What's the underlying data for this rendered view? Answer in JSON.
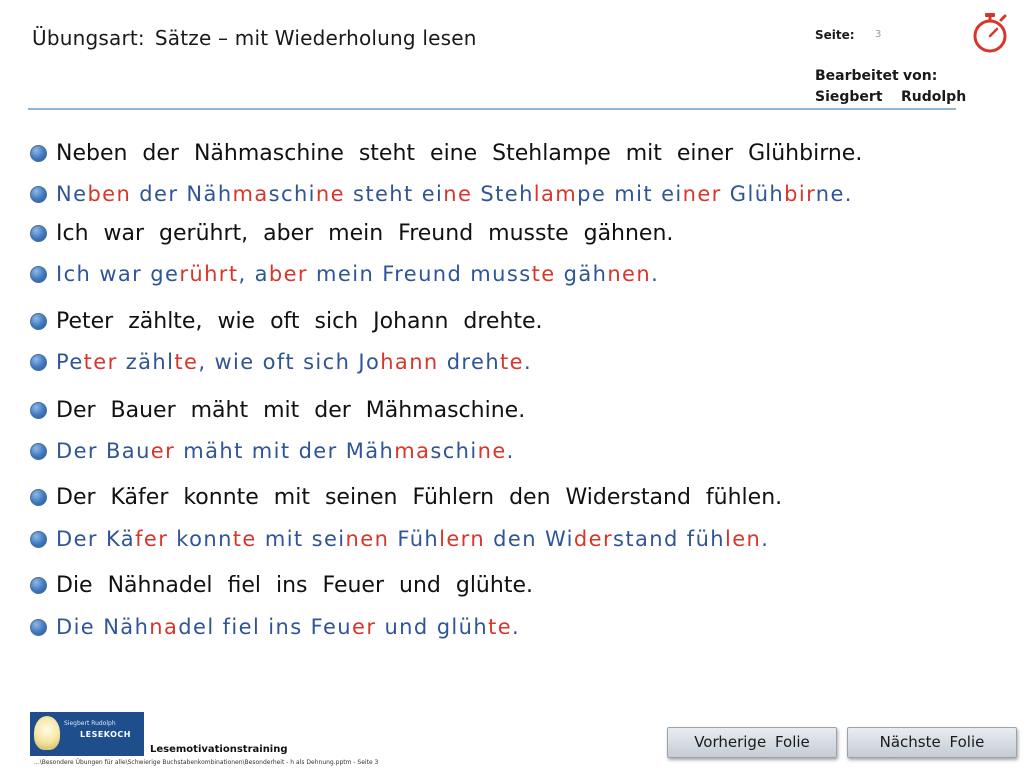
{
  "header": {
    "exercise_label": "Übungsart:",
    "exercise_value": "Sätze – mit Wiederholung lesen",
    "page_label": "Seite:",
    "page_number": "3",
    "edited_label_1": "Bearbeitet",
    "edited_label_2": "von:",
    "editor_first": "Siegbert",
    "editor_last": "Rudolph"
  },
  "icons": {
    "timer": "stopwatch-icon",
    "bullet": "blue-circle-bullet-icon"
  },
  "colors": {
    "syllable_blue": "#2f5597",
    "syllable_red": "#d9362b",
    "rule": "#8fb3d9"
  },
  "sentences": [
    {
      "plain": "Neben der Nähmaschine steht eine Stehlampe mit einer Glühbirne.",
      "segments": [
        [
          "Ne",
          0
        ],
        [
          "ben",
          1
        ],
        [
          " der Näh",
          0
        ],
        [
          "ma",
          1
        ],
        [
          "schi",
          0
        ],
        [
          "ne",
          1
        ],
        [
          " steht ei",
          0
        ],
        [
          "ne",
          1
        ],
        [
          " Steh",
          0
        ],
        [
          "lam",
          1
        ],
        [
          "pe mit ei",
          0
        ],
        [
          "ner",
          1
        ],
        [
          " Glüh",
          0
        ],
        [
          "bir",
          1
        ],
        [
          "ne.",
          0
        ]
      ]
    },
    {
      "plain": "Ich war gerührt, aber mein Freund musste gähnen.",
      "segments": [
        [
          "Ich war ge",
          0
        ],
        [
          "rührt",
          1
        ],
        [
          ", a",
          0
        ],
        [
          "ber",
          1
        ],
        [
          " mein Freund muss",
          0
        ],
        [
          "te",
          1
        ],
        [
          " gäh",
          0
        ],
        [
          "nen",
          1
        ],
        [
          ".",
          0
        ]
      ]
    },
    {
      "plain": "Peter zählte, wie oft sich Johann drehte.",
      "segments": [
        [
          "Pe",
          0
        ],
        [
          "ter",
          1
        ],
        [
          " zähl",
          0
        ],
        [
          "te",
          1
        ],
        [
          ", wie oft sich Jo",
          0
        ],
        [
          "hann",
          1
        ],
        [
          " dreh",
          0
        ],
        [
          "te",
          1
        ],
        [
          ".",
          0
        ]
      ]
    },
    {
      "plain": "Der Bauer mäht mit der Mähmaschine.",
      "segments": [
        [
          "Der Bau",
          0
        ],
        [
          "er",
          1
        ],
        [
          " mäht mit der Mäh",
          0
        ],
        [
          "ma",
          1
        ],
        [
          "schi",
          0
        ],
        [
          "ne",
          1
        ],
        [
          ".",
          0
        ]
      ]
    },
    {
      "plain": "Der Käfer konnte mit seinen Fühlern den Widerstand fühlen.",
      "segments": [
        [
          "Der Kä",
          0
        ],
        [
          "fer",
          1
        ],
        [
          " konn",
          0
        ],
        [
          "te",
          1
        ],
        [
          " mit sei",
          0
        ],
        [
          "nen",
          1
        ],
        [
          " Füh",
          0
        ],
        [
          "lern",
          1
        ],
        [
          " den Wi",
          0
        ],
        [
          "der",
          1
        ],
        [
          "stand füh",
          0
        ],
        [
          "len",
          1
        ],
        [
          ".",
          0
        ]
      ]
    },
    {
      "plain": "Die Nähnadel fiel ins Feuer und glühte.",
      "segments": [
        [
          "Die Näh",
          0
        ],
        [
          "na",
          1
        ],
        [
          "del fiel ins Feu",
          0
        ],
        [
          "er",
          1
        ],
        [
          " und glüh",
          0
        ],
        [
          "te",
          1
        ],
        [
          ".",
          0
        ]
      ]
    }
  ],
  "footer": {
    "logo_small_text": "Siegbert Rudolph",
    "logo_big_text": "LESEKOCH",
    "program_label": "Lesemotivationstraining",
    "file_path": "...\\Besondere Übungen für alle\\Schwierige Buchstabenkombinationen\\Besonderheit - h als Dehnung.pptm - Seite 3"
  },
  "nav": {
    "prev_label": "Vorherige Folie",
    "next_label": "Nächste Folie"
  }
}
